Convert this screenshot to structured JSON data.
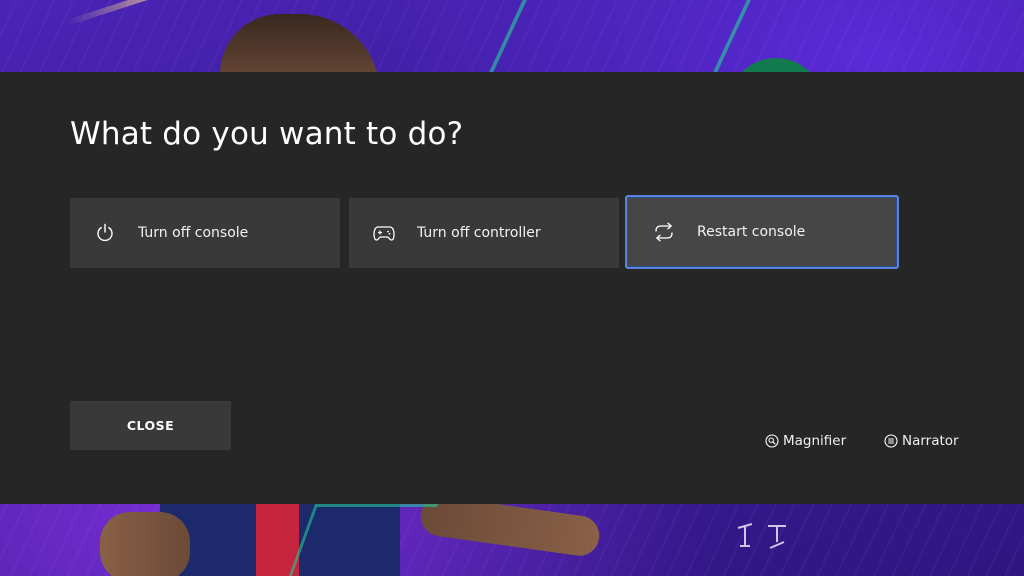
{
  "dialog": {
    "title": "What do you want to do?",
    "options": [
      {
        "label": "Turn off console",
        "icon": "power-icon"
      },
      {
        "label": "Turn off controller",
        "icon": "controller-icon"
      },
      {
        "label": "Restart console",
        "icon": "restart-icon",
        "focused": true
      }
    ],
    "close_label": "CLOSE"
  },
  "accessibility": {
    "magnifier_label": "Magnifier",
    "magnifier_icon": "magnifier-icon",
    "narrator_label": "Narrator",
    "narrator_icon": "narrator-icon"
  },
  "colors": {
    "dialog_background": "#262626",
    "tile_background": "#393939",
    "focused_tile_background": "#464646",
    "focus_border": "#5b82d6",
    "text": "#ffffff"
  }
}
